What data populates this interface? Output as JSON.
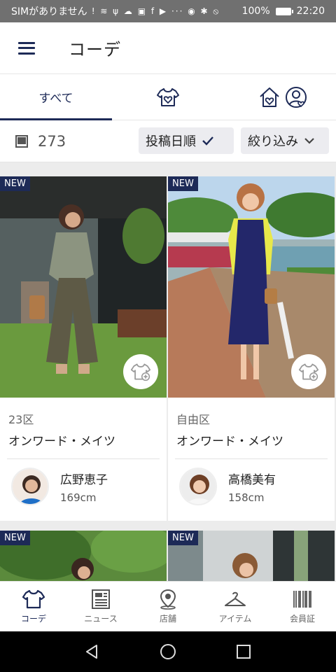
{
  "status_bar": {
    "carrier": "SIMがありません",
    "battery_pct": "100%",
    "time": "22:20",
    "icons_text": "! ≋ ψ ☁ ▣ f ▶ ··· ◉ ✱ ⦸"
  },
  "header": {
    "title": "コーデ"
  },
  "tabs": {
    "all_label": "すべて"
  },
  "filter_bar": {
    "count": "273",
    "sort_label": "投稿日順",
    "filter_label": "絞り込み"
  },
  "cards": [
    {
      "badge": "NEW",
      "brand": "23区",
      "shop": "オンワード・メイツ",
      "staff_name": "広野恵子",
      "staff_height": "169cm"
    },
    {
      "badge": "NEW",
      "brand": "自由区",
      "shop": "オンワード・メイツ",
      "staff_name": "高橋美有",
      "staff_height": "158cm"
    },
    {
      "badge": "NEW"
    },
    {
      "badge": "NEW"
    }
  ],
  "bottom_nav": [
    {
      "label": "コーデ",
      "icon": "tshirt-icon"
    },
    {
      "label": "ニュース",
      "icon": "news-icon"
    },
    {
      "label": "店舗",
      "icon": "map-pin-icon"
    },
    {
      "label": "アイテム",
      "icon": "hanger-icon"
    },
    {
      "label": "会員証",
      "icon": "barcode-icon"
    }
  ],
  "colors": {
    "accent": "#1d2a57",
    "status_bar": "#707070"
  }
}
